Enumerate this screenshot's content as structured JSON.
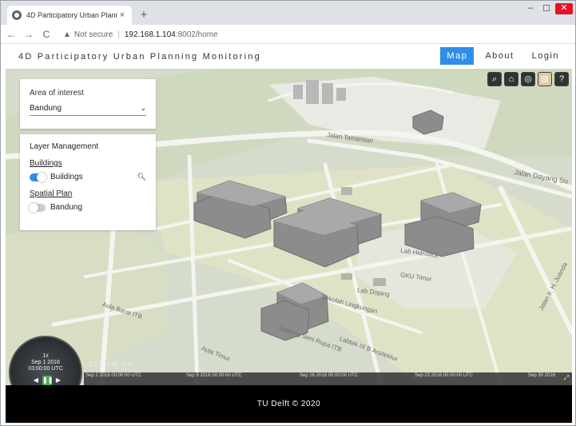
{
  "browser": {
    "tab_title": "4D Participatory Urban Planning",
    "url_warning": "Not secure",
    "url_host": "192.168.1.104",
    "url_path": ":8002/home",
    "new_tab_symbol": "+",
    "close_symbol": "×"
  },
  "app": {
    "title": "4D Participatory Urban Planning Monitoring",
    "nav": [
      {
        "label": "Map",
        "active": true
      },
      {
        "label": "About",
        "active": false
      },
      {
        "label": "Login",
        "active": false
      }
    ]
  },
  "area_of_interest": {
    "label": "Area of interest",
    "selected": "Bandung"
  },
  "layer_management": {
    "title": "Layer Management",
    "groups": [
      {
        "title": "Buildings",
        "layers": [
          {
            "label": "Buildings",
            "enabled": true
          }
        ]
      },
      {
        "title": "Spatial Plan",
        "layers": [
          {
            "label": "Bandung",
            "enabled": false
          }
        ]
      }
    ]
  },
  "map": {
    "street_labels": [
      "Jalan Tamansari",
      "Jalan Dayang Su",
      "Lab Doping",
      "Sekolah Lingkungan",
      "Gedung Seni Rupa ITB",
      "Aula Barat ITB",
      "Labtek IX B Arsitektur",
      "Lab Hidrolika",
      "GKU Timur",
      "Aula Timur",
      "Jalan Ir. H. Juanda"
    ]
  },
  "animation": {
    "speed": "1x",
    "date": "Sep 1 2016",
    "time": "03:00:00 UTC"
  },
  "timeline": {
    "ticks": [
      "Sep 2 2016 00:00:00 UTC",
      "Sep 9 2016 00:00:00 UTC",
      "Sep 16 2016 00:00:00 UTC",
      "Sep 23 2016 00:00:00 UTC",
      "Sep 30 2016"
    ]
  },
  "credits": {
    "text": "CESIUM ion"
  },
  "footer": {
    "text": "TU Delft © 2020"
  },
  "colors": {
    "accent": "#2f8fe8",
    "footer_bg": "#000000",
    "map_base": "#d6dccb"
  }
}
